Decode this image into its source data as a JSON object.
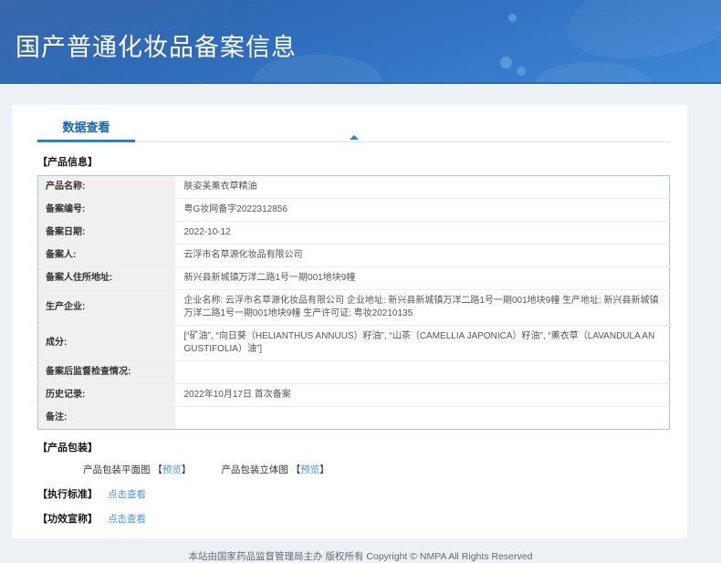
{
  "header": {
    "title": "国产普通化妆品备案信息"
  },
  "tab": {
    "label": "数据查看"
  },
  "sections": {
    "product_info": "【产品信息】",
    "packaging": "【产品包装】",
    "standard": "【执行标准】",
    "efficacy": "【功效宣称】"
  },
  "table": {
    "rows": [
      {
        "label": "产品名称:",
        "value": "肤姿美薰衣草精油"
      },
      {
        "label": "备案编号:",
        "value": "粤G妆网备字2022312856"
      },
      {
        "label": "备案日期:",
        "value": "2022-10-12"
      },
      {
        "label": "备案人:",
        "value": "云浮市名草源化妆品有限公司"
      },
      {
        "label": "备案人住所地址:",
        "value": "新兴县新城镇万洋二路1号一期001地块9幢"
      },
      {
        "label": "生产企业:",
        "value": "企业名称: 云浮市名草源化妆品有限公司 企业地址: 新兴县新城镇万洋二路1号一期001地块9幢 生产地址: 新兴县新城镇万洋二路1号一期001地块9幢 生产许可证: 粤妆20210135"
      },
      {
        "label": "成分:",
        "value": "[“矿油”, “向日葵（HELIANTHUS ANNUUS）籽油”, “山茶（CAMELLIA JAPONICA）籽油”, “薰衣草（LAVANDULA ANGUSTIFOLIA）油”]"
      },
      {
        "label": "备案后监督检查情况:",
        "value": ""
      },
      {
        "label": "历史记录:",
        "value": "2022年10月17日 首次备案"
      },
      {
        "label": "备注:",
        "value": ""
      }
    ]
  },
  "packaging": {
    "flat_label": "产品包装平面图",
    "stereo_label": "产品包装立体图",
    "preview": "预览",
    "bracket_open": "【",
    "bracket_close": "】"
  },
  "links": {
    "click_to_view": "点击查看"
  },
  "footer": {
    "copyright": "本站由国家药品监督管理局主办 版权所有 Copyright © NMPA All Rights Reserved"
  },
  "colors": {
    "header_blue_top": "#2c5ea7",
    "header_blue_bottom": "#3e87d6",
    "tab_text_blue": "#1565af",
    "tab_underline_blue": "#1f83dd",
    "link_blue": "#4795e0",
    "table_border_blue": "#a9c5e2",
    "label_cell_gray": "#f0f0f0",
    "page_background": "#edf1f5"
  }
}
